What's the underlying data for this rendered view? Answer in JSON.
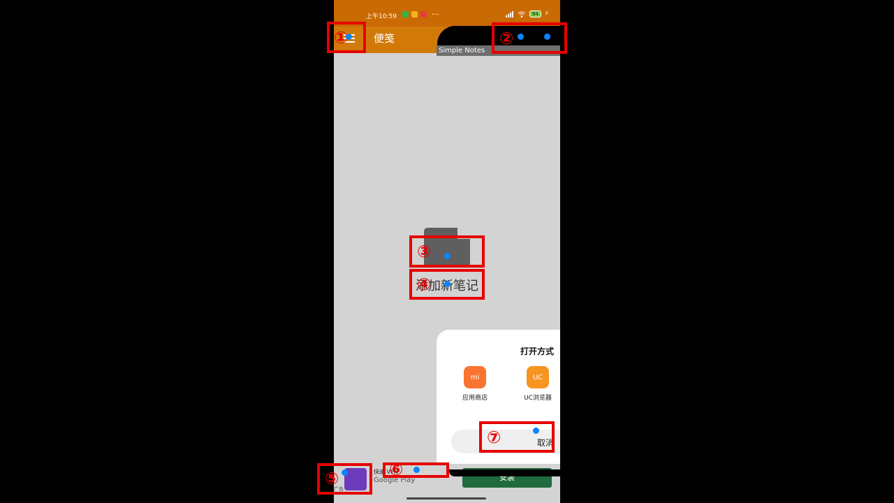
{
  "status": {
    "time": "上午10:59",
    "more": "···",
    "battery": "94"
  },
  "app": {
    "title": "便笺",
    "notes_label": "Simple Notes"
  },
  "empty_state": {
    "text": "添加新笔记"
  },
  "sheet": {
    "title": "打开方式",
    "apps": [
      {
        "label": "应用商店",
        "icon": "mi-store-icon",
        "color": "#f97331",
        "glyph": "mi"
      },
      {
        "label": "UC浏览器",
        "icon": "uc-browser-icon",
        "color": "#f79422",
        "glyph": "UC"
      }
    ],
    "cancel": "取消"
  },
  "ad": {
    "label": "快速",
    "vpn": "VPN",
    "store": "Google Play",
    "badge": "广告",
    "install": "安装"
  },
  "annotations": [
    "①",
    "②",
    "③",
    "④",
    "⑤",
    "⑥",
    "⑦"
  ]
}
